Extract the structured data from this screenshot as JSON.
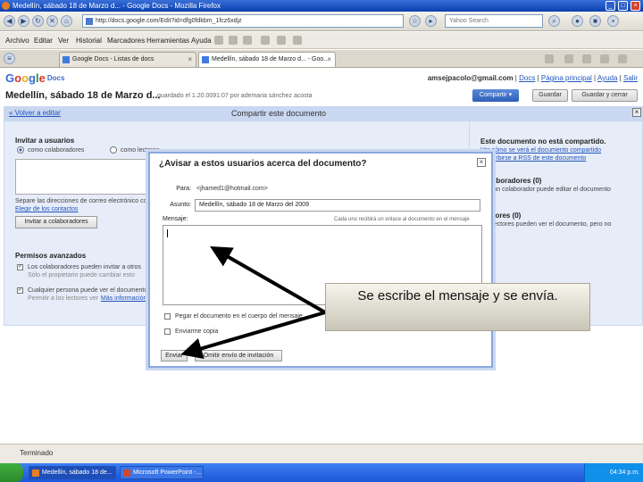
{
  "window": {
    "title": "Medellín, sábado 18 de Marzo d... - Google Docs - Mozilla Firefox"
  },
  "nav": {
    "url": "http://docs.google.com/Edit?id=dfg0fdkbm_1fcz6xdjz",
    "search_placeholder": "Yahoo Search"
  },
  "menu": {
    "items": [
      "Archivo",
      "Editar",
      "Ver",
      "Historial",
      "Marcadores",
      "Herramientas",
      "Ayuda"
    ]
  },
  "tabs": [
    {
      "label": "Google Docs - Listas de docs",
      "active": false
    },
    {
      "label": "Medellín, sábado 18 de Marzo d... - Goo...",
      "active": true
    }
  ],
  "page": {
    "logo": {
      "letters": [
        "G",
        "o",
        "o",
        "g",
        "l",
        "e"
      ],
      "product": "Docs"
    },
    "user": {
      "email": "amsejpacolo@gmail.com",
      "links": [
        "Docs",
        "Página principal",
        "Ayuda",
        "Salir"
      ]
    },
    "doc_title": "Medellín, sábado 18 de Marzo d...",
    "saved_info": "guardado el 1.20.0091:07 por ademaria sánchez acosta",
    "buttons": {
      "compartir": "Compartir ▾",
      "guardar": "Guardar",
      "guardar_cerrar": "Guardar y cerrar"
    },
    "share": {
      "back_link": "« Volver a editar",
      "title": "Compartir este documento",
      "invitar_heading": "Invitar a usuarios",
      "radio_colaboradores": "como colaboradores",
      "radio_lectores": "como lectores",
      "separator_hint": "Separe las direcciones de correo electrónico con comas",
      "contacts_link": "Elegir de los contactos",
      "invite_button": "Invitar a colaboradores",
      "advanced_heading": "Permisos avanzados",
      "perm1": "Los colaboradores pueden invitar a otros",
      "perm1_sub": "Sólo el propietario puede cambiar esto",
      "perm2": "Cualquier persona puede ver el documento",
      "perm2_sub": "Permitir a los lectores ver",
      "more_info": "Más información",
      "right_heading": "Este documento no está compartido.",
      "right_link1": "Ver cómo se verá el documento compartido",
      "right_link2": "Suscribirse a RSS de este documento",
      "collab_heading": "Colaboradores (0)",
      "collab_text": "Ningún colaborador puede editar el documento",
      "viewers_heading": "Lectores (0)",
      "viewers_text": "Los lectores pueden ver el documento, pero no"
    }
  },
  "dialog": {
    "title": "¿Avisar a estos usuarios acerca del documento?",
    "para_label": "Para:",
    "para_value": "<jhamed1@hotmail.com>",
    "asunto_label": "Asunto:",
    "asunto_value": "Medellín, sábado 18 de Marzo del 2009",
    "mensaje_label": "Mensaje:",
    "mensaje_hint": "Cada uno recibirá un enlace al documento en el mensaje",
    "mensaje_value": "",
    "chk1_label": "Pegar el documento en el cuerpo del mensaje",
    "chk2_label": "Enviarme copia",
    "send_button": "Enviar",
    "skip_button": "Omitir envío de invitación"
  },
  "callout": {
    "text": "Se escribe el mensaje y se envía."
  },
  "status": {
    "text": "Terminado"
  },
  "taskbar": {
    "tasks": [
      {
        "label": "Medellín, sábado 18 de...",
        "active": true
      },
      {
        "label": "Microsoft PowerPoint -...",
        "active": false
      }
    ],
    "clock": "04:34 p.m."
  },
  "colors": {
    "accent": "#3a6bd6",
    "share_bg": "#e6ecf8",
    "taskbar": "#245edb"
  }
}
